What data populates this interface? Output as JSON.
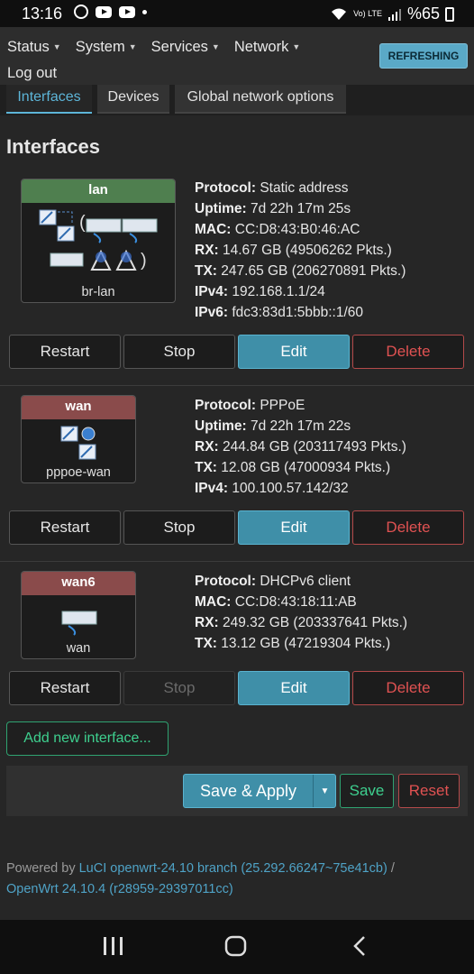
{
  "statusbar": {
    "time": "13:16",
    "battery": "%65",
    "volte": "Vo) LTE"
  },
  "nav": {
    "items": [
      {
        "label": "Status"
      },
      {
        "label": "System"
      },
      {
        "label": "Services"
      },
      {
        "label": "Network"
      }
    ],
    "logout": "Log out",
    "refresh": "REFRESHING"
  },
  "tabs": [
    "Interfaces",
    "Devices",
    "Global network options"
  ],
  "page_title": "Interfaces",
  "interfaces": [
    {
      "name": "lan",
      "device": "br-lan",
      "header_color": "#4f7f4f",
      "info": [
        {
          "k": "Protocol:",
          "v": " Static address"
        },
        {
          "k": "Uptime:",
          "v": " 7d 22h 17m 25s"
        },
        {
          "k": "MAC:",
          "v": " CC:D8:43:B0:46:AC"
        },
        {
          "k": "RX:",
          "v": " 14.67 GB (49506262 Pkts.)"
        },
        {
          "k": "TX:",
          "v": " 247.65 GB (206270891 Pkts.)"
        },
        {
          "k": "IPv4:",
          "v": " 192.168.1.1/24"
        },
        {
          "k": "IPv6:",
          "v": " fdc3:83d1:5bbb::1/60"
        }
      ],
      "buttons": {
        "restart": "Restart",
        "stop": "Stop",
        "edit": "Edit",
        "delete": "Delete"
      }
    },
    {
      "name": "wan",
      "device": "pppoe-wan",
      "header_color": "#8a4b4b",
      "info": [
        {
          "k": "Protocol:",
          "v": " PPPoE"
        },
        {
          "k": "Uptime:",
          "v": " 7d 22h 17m 22s"
        },
        {
          "k": "RX:",
          "v": " 244.84 GB (203117493 Pkts.)"
        },
        {
          "k": "TX:",
          "v": " 12.08 GB (47000934 Pkts.)"
        },
        {
          "k": "IPv4:",
          "v": " 100.100.57.142/32"
        }
      ],
      "buttons": {
        "restart": "Restart",
        "stop": "Stop",
        "edit": "Edit",
        "delete": "Delete"
      }
    },
    {
      "name": "wan6",
      "device": "wan",
      "header_color": "#8a4b4b",
      "info": [
        {
          "k": "Protocol:",
          "v": " DHCPv6 client"
        },
        {
          "k": "MAC:",
          "v": " CC:D8:43:18:11:AB"
        },
        {
          "k": "RX:",
          "v": " 249.32 GB (203337641 Pkts.)"
        },
        {
          "k": "TX:",
          "v": " 13.12 GB (47219304 Pkts.)"
        }
      ],
      "buttons": {
        "restart": "Restart",
        "stop": "Stop",
        "edit": "Edit",
        "delete": "Delete"
      }
    }
  ],
  "add_interface": "Add new interface...",
  "actions": {
    "save_apply": "Save & Apply",
    "save": "Save",
    "reset": "Reset"
  },
  "footer": {
    "powered_by": "Powered by",
    "luci_link": "LuCI openwrt-24.10 branch (25.292.66247~75e41cb)",
    "slash": " /",
    "openwrt_link": "OpenWrt 24.10.4 (r28959-29397011cc)"
  },
  "colors": {
    "accent": "#5db5d8",
    "edit": "#3f8fa8",
    "danger": "#e05252",
    "positive": "#3ed08f"
  }
}
